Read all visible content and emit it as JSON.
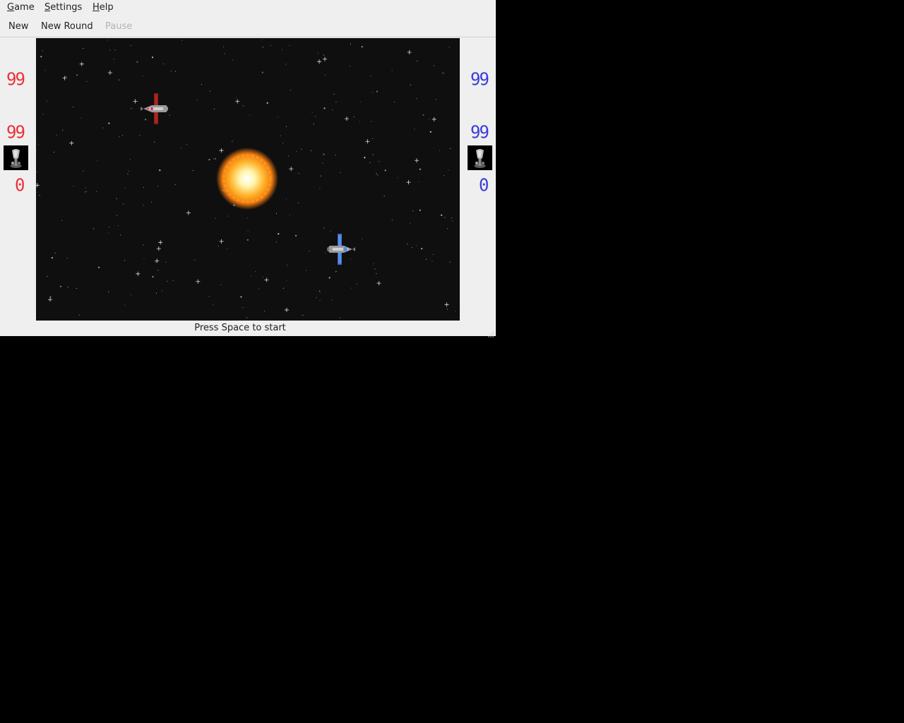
{
  "menu": {
    "game": {
      "accel": "G",
      "rest": "ame"
    },
    "settings": {
      "accel": "S",
      "rest": "ettings"
    },
    "help": {
      "accel": "H",
      "rest": "elp"
    }
  },
  "toolbar": {
    "new_label": "New",
    "new_round_label": "New Round",
    "pause_label": "Pause"
  },
  "players": {
    "red": {
      "color": "#e8343a",
      "energy": "99",
      "shield": "99",
      "score": "0",
      "control_icon": "joystick-icon"
    },
    "blue": {
      "color": "#3b3ed6",
      "energy": "99",
      "shield": "99",
      "score": "0",
      "control_icon": "joystick-icon"
    }
  },
  "arena": {
    "background": "starfield",
    "objects": [
      "sun-icon",
      "red-ship-icon",
      "blue-ship-icon"
    ]
  },
  "status": "Press Space to start"
}
